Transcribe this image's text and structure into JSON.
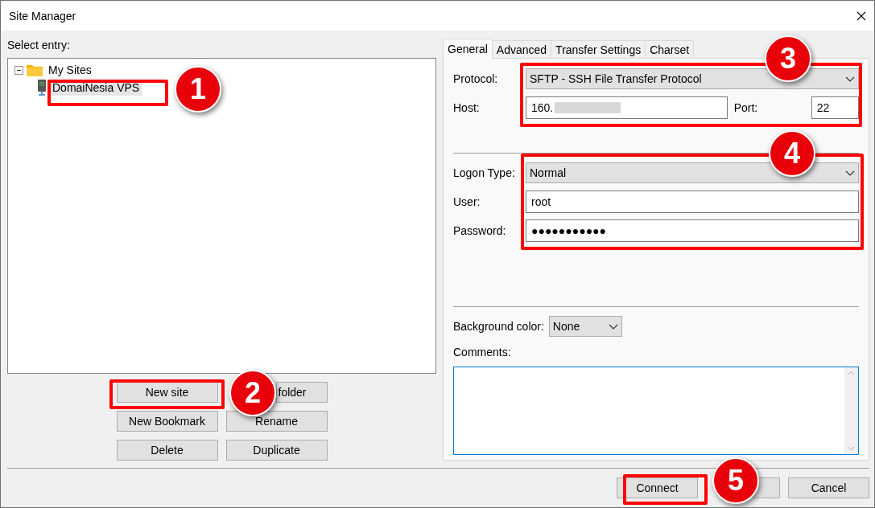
{
  "window": {
    "title": "Site Manager"
  },
  "select_entry_label": "Select entry:",
  "tree": [
    {
      "label": "My Sites",
      "kind": "folder",
      "expanded": true,
      "selected": false,
      "children": [
        {
          "label": "DomaiNesia VPS",
          "kind": "site",
          "selected": true
        }
      ]
    }
  ],
  "tree_buttons": [
    {
      "label": "New site"
    },
    {
      "label": "folder",
      "kind": "covered"
    },
    {
      "label": "New Bookmark"
    },
    {
      "label": "Rename"
    },
    {
      "label": "Delete"
    },
    {
      "label": "Duplicate"
    }
  ],
  "tabs": [
    {
      "label": "General",
      "selected": true
    },
    {
      "label": "Advanced",
      "selected": false
    },
    {
      "label": "Transfer Settings",
      "selected": false
    },
    {
      "label": "Charset",
      "selected": false
    }
  ],
  "protocol": {
    "label": "Protocol:",
    "value": "SFTP - SSH File Transfer Protocol"
  },
  "host": {
    "label": "Host:",
    "value": "160."
  },
  "port": {
    "label": "Port:",
    "value": "22"
  },
  "logon_type": {
    "label": "Logon Type:",
    "value": "Normal"
  },
  "user": {
    "label": "User:",
    "value": "root"
  },
  "password": {
    "label": "Password:",
    "value": "●●●●●●●●●●●"
  },
  "background_color": {
    "label": "Background color:",
    "value": "None"
  },
  "comments": {
    "label": "Comments:"
  },
  "dialog_buttons": [
    {
      "label": "Connect"
    },
    {
      "kind": "covered"
    },
    {
      "label": "Cancel"
    }
  ],
  "callouts": [
    {
      "number": "1"
    },
    {
      "number": "2"
    },
    {
      "number": "3"
    },
    {
      "number": "4"
    },
    {
      "number": "5"
    }
  ]
}
